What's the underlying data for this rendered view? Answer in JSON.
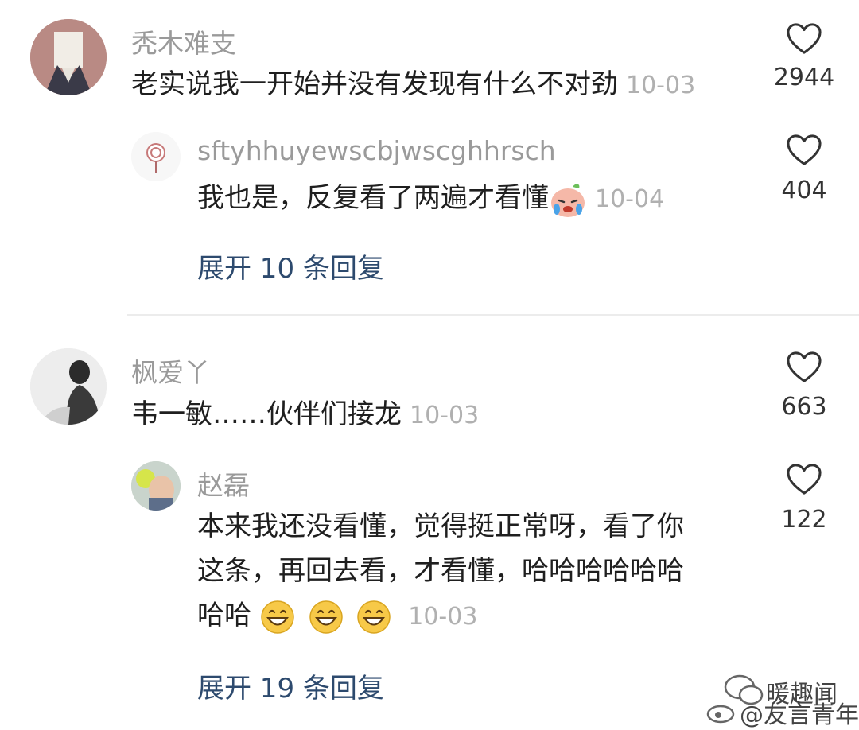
{
  "comments": [
    {
      "username": "秃木难支",
      "text": "老实说我一开始并没有发现有什么不对劲",
      "date": "10-03",
      "likes": "2944",
      "reply": {
        "username": "sftyhhuyewscbjwscghhrsch",
        "text": "我也是，反复看了两遍才看懂",
        "emoji": "crying-face",
        "date": "10-04",
        "likes": "404"
      },
      "expand_label": "展开 10 条回复"
    },
    {
      "username": "枫爱丫",
      "text": "韦一敏……伙伴们接龙",
      "date": "10-03",
      "likes": "663",
      "reply": {
        "username": "赵磊",
        "text_lines": [
          "本来我还没看懂，觉得挺正常呀，看了你",
          "这条，再回去看，才看懂，哈哈哈哈哈哈",
          "哈哈"
        ],
        "emoji": "grinning-face",
        "date": "10-03",
        "likes": "122"
      },
      "expand_label": "展开 19 条回复"
    }
  ],
  "watermark": {
    "line1": "暖趣闻",
    "line2": "@友言青年"
  }
}
